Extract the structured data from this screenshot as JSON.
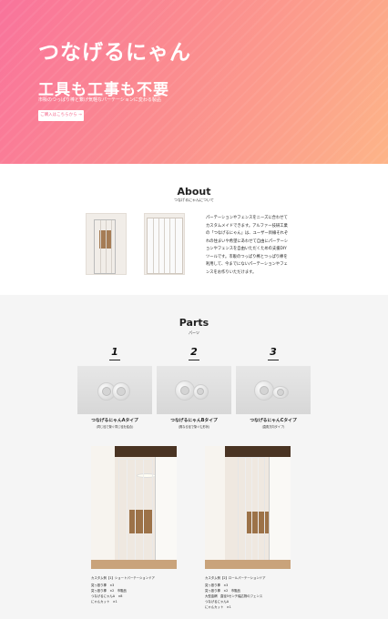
{
  "hero": {
    "brand": "つなげるにゃん",
    "tagline": "工具も工事も不要",
    "subline": "市販のつっぱり棒と繋げ気軽なパーテーションに変わる製品",
    "cta_label": "ご購入はこちらから →"
  },
  "about": {
    "title": "About",
    "subtitle": "つなげるにゃんについて",
    "body": "パーテーションやフェンスをニーズに合わせてカスタムメイドできます。アルファー技研工業の「つなげるにゃん」は、ユーザー目線それぞれの住まいや希望にあわせて自由にパーテーションやフェンスを自由いただくための支援DIYツールです。市販のつっぱり棒とつっぱり棒を利用して、今までにないパーテーションやフェンスをお作りいただけます。"
  },
  "parts": {
    "title": "Parts",
    "subtitle": "パーツ",
    "items": [
      {
        "num": "1",
        "name": "つなげるにゃんAタイプ",
        "note": "(同じ径で繋ぐ同じ径を結合)"
      },
      {
        "num": "2",
        "name": "つなげるにゃんBタイプ",
        "note": "(異なる径で繋ぐむ形状)"
      },
      {
        "num": "3",
        "name": "つなげるにゃんCタイプ",
        "note": "(直角方向タイプ)"
      }
    ],
    "examples": [
      {
        "caption": "カスタム例【1】ショートパーテーションドア",
        "specs": [
          "突っ張り棒　×3",
          "突っ張り棒　×2　市販品",
          "つなげるにゃんA　×8",
          "にゃんカット　×1"
        ]
      },
      {
        "caption": "カスタム例【2】ロールパーテーションドア",
        "specs": [
          "突っ張り棒　×3",
          "突っ張り棒　×2　市販品",
          "大型金網　直径5センチ幅広物のフェンス",
          "つなげるにゃんA",
          "にゃんカット　×1"
        ]
      }
    ]
  },
  "colors": {
    "hero_start": "#f9739b",
    "hero_end": "#fdb488",
    "parts_bg": "#f5f5f5"
  }
}
